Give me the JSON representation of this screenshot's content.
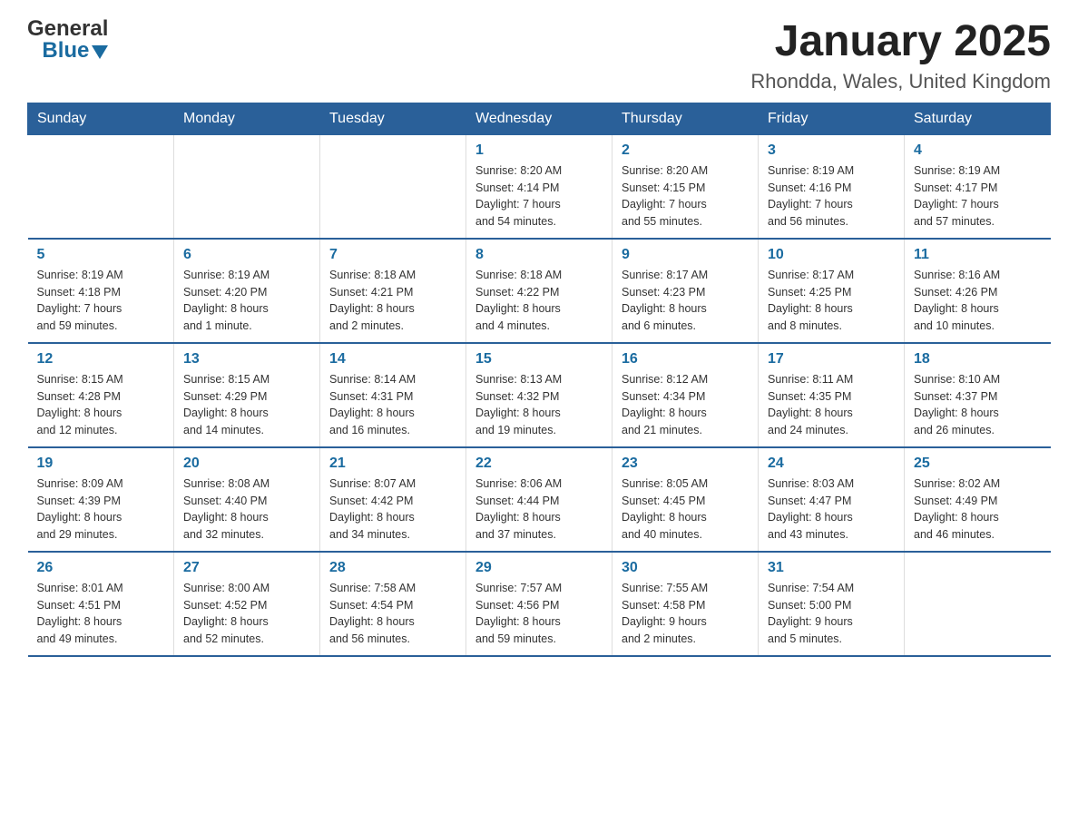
{
  "header": {
    "logo_general": "General",
    "logo_blue": "Blue",
    "title": "January 2025",
    "subtitle": "Rhondda, Wales, United Kingdom"
  },
  "days_of_week": [
    "Sunday",
    "Monday",
    "Tuesday",
    "Wednesday",
    "Thursday",
    "Friday",
    "Saturday"
  ],
  "weeks": [
    [
      {
        "day": "",
        "info": ""
      },
      {
        "day": "",
        "info": ""
      },
      {
        "day": "",
        "info": ""
      },
      {
        "day": "1",
        "info": "Sunrise: 8:20 AM\nSunset: 4:14 PM\nDaylight: 7 hours\nand 54 minutes."
      },
      {
        "day": "2",
        "info": "Sunrise: 8:20 AM\nSunset: 4:15 PM\nDaylight: 7 hours\nand 55 minutes."
      },
      {
        "day": "3",
        "info": "Sunrise: 8:19 AM\nSunset: 4:16 PM\nDaylight: 7 hours\nand 56 minutes."
      },
      {
        "day": "4",
        "info": "Sunrise: 8:19 AM\nSunset: 4:17 PM\nDaylight: 7 hours\nand 57 minutes."
      }
    ],
    [
      {
        "day": "5",
        "info": "Sunrise: 8:19 AM\nSunset: 4:18 PM\nDaylight: 7 hours\nand 59 minutes."
      },
      {
        "day": "6",
        "info": "Sunrise: 8:19 AM\nSunset: 4:20 PM\nDaylight: 8 hours\nand 1 minute."
      },
      {
        "day": "7",
        "info": "Sunrise: 8:18 AM\nSunset: 4:21 PM\nDaylight: 8 hours\nand 2 minutes."
      },
      {
        "day": "8",
        "info": "Sunrise: 8:18 AM\nSunset: 4:22 PM\nDaylight: 8 hours\nand 4 minutes."
      },
      {
        "day": "9",
        "info": "Sunrise: 8:17 AM\nSunset: 4:23 PM\nDaylight: 8 hours\nand 6 minutes."
      },
      {
        "day": "10",
        "info": "Sunrise: 8:17 AM\nSunset: 4:25 PM\nDaylight: 8 hours\nand 8 minutes."
      },
      {
        "day": "11",
        "info": "Sunrise: 8:16 AM\nSunset: 4:26 PM\nDaylight: 8 hours\nand 10 minutes."
      }
    ],
    [
      {
        "day": "12",
        "info": "Sunrise: 8:15 AM\nSunset: 4:28 PM\nDaylight: 8 hours\nand 12 minutes."
      },
      {
        "day": "13",
        "info": "Sunrise: 8:15 AM\nSunset: 4:29 PM\nDaylight: 8 hours\nand 14 minutes."
      },
      {
        "day": "14",
        "info": "Sunrise: 8:14 AM\nSunset: 4:31 PM\nDaylight: 8 hours\nand 16 minutes."
      },
      {
        "day": "15",
        "info": "Sunrise: 8:13 AM\nSunset: 4:32 PM\nDaylight: 8 hours\nand 19 minutes."
      },
      {
        "day": "16",
        "info": "Sunrise: 8:12 AM\nSunset: 4:34 PM\nDaylight: 8 hours\nand 21 minutes."
      },
      {
        "day": "17",
        "info": "Sunrise: 8:11 AM\nSunset: 4:35 PM\nDaylight: 8 hours\nand 24 minutes."
      },
      {
        "day": "18",
        "info": "Sunrise: 8:10 AM\nSunset: 4:37 PM\nDaylight: 8 hours\nand 26 minutes."
      }
    ],
    [
      {
        "day": "19",
        "info": "Sunrise: 8:09 AM\nSunset: 4:39 PM\nDaylight: 8 hours\nand 29 minutes."
      },
      {
        "day": "20",
        "info": "Sunrise: 8:08 AM\nSunset: 4:40 PM\nDaylight: 8 hours\nand 32 minutes."
      },
      {
        "day": "21",
        "info": "Sunrise: 8:07 AM\nSunset: 4:42 PM\nDaylight: 8 hours\nand 34 minutes."
      },
      {
        "day": "22",
        "info": "Sunrise: 8:06 AM\nSunset: 4:44 PM\nDaylight: 8 hours\nand 37 minutes."
      },
      {
        "day": "23",
        "info": "Sunrise: 8:05 AM\nSunset: 4:45 PM\nDaylight: 8 hours\nand 40 minutes."
      },
      {
        "day": "24",
        "info": "Sunrise: 8:03 AM\nSunset: 4:47 PM\nDaylight: 8 hours\nand 43 minutes."
      },
      {
        "day": "25",
        "info": "Sunrise: 8:02 AM\nSunset: 4:49 PM\nDaylight: 8 hours\nand 46 minutes."
      }
    ],
    [
      {
        "day": "26",
        "info": "Sunrise: 8:01 AM\nSunset: 4:51 PM\nDaylight: 8 hours\nand 49 minutes."
      },
      {
        "day": "27",
        "info": "Sunrise: 8:00 AM\nSunset: 4:52 PM\nDaylight: 8 hours\nand 52 minutes."
      },
      {
        "day": "28",
        "info": "Sunrise: 7:58 AM\nSunset: 4:54 PM\nDaylight: 8 hours\nand 56 minutes."
      },
      {
        "day": "29",
        "info": "Sunrise: 7:57 AM\nSunset: 4:56 PM\nDaylight: 8 hours\nand 59 minutes."
      },
      {
        "day": "30",
        "info": "Sunrise: 7:55 AM\nSunset: 4:58 PM\nDaylight: 9 hours\nand 2 minutes."
      },
      {
        "day": "31",
        "info": "Sunrise: 7:54 AM\nSunset: 5:00 PM\nDaylight: 9 hours\nand 5 minutes."
      },
      {
        "day": "",
        "info": ""
      }
    ]
  ]
}
